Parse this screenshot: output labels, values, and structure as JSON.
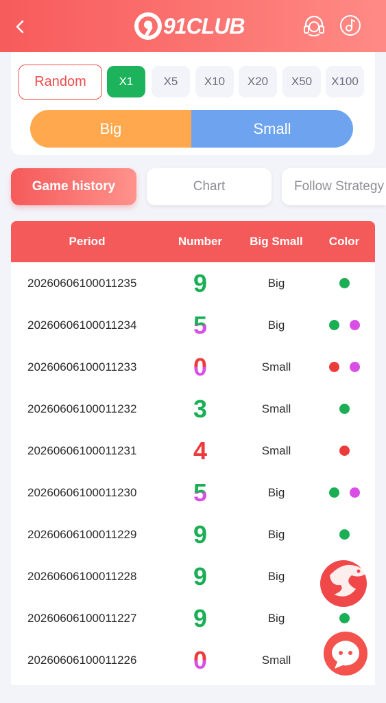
{
  "header": {
    "brand": "91CLUB",
    "icons": [
      "back-icon",
      "headset-icon",
      "music-icon"
    ]
  },
  "bet": {
    "random_label": "Random",
    "multipliers": [
      "X1",
      "X5",
      "X10",
      "X20",
      "X50",
      "X100"
    ],
    "selected_multiplier": "X1",
    "big_label": "Big",
    "small_label": "Small"
  },
  "tabs": {
    "game_history": "Game history",
    "chart": "Chart",
    "follow_strategy": "Follow Strategy",
    "active": "Game history"
  },
  "table": {
    "headers": {
      "period": "Period",
      "number": "Number",
      "big_small": "Big Small",
      "color": "Color"
    },
    "rows": [
      {
        "period": "20260606100011235",
        "number": "9",
        "big_small": "Big",
        "colors": [
          "green"
        ]
      },
      {
        "period": "20260606100011234",
        "number": "5",
        "big_small": "Big",
        "colors": [
          "green",
          "violet"
        ]
      },
      {
        "period": "20260606100011233",
        "number": "0",
        "big_small": "Small",
        "colors": [
          "red",
          "violet"
        ]
      },
      {
        "period": "20260606100011232",
        "number": "3",
        "big_small": "Small",
        "colors": [
          "green"
        ]
      },
      {
        "period": "20260606100011231",
        "number": "4",
        "big_small": "Small",
        "colors": [
          "red"
        ]
      },
      {
        "period": "20260606100011230",
        "number": "5",
        "big_small": "Big",
        "colors": [
          "green",
          "violet"
        ]
      },
      {
        "period": "20260606100011229",
        "number": "9",
        "big_small": "Big",
        "colors": [
          "green"
        ]
      },
      {
        "period": "20260606100011228",
        "number": "9",
        "big_small": "Big",
        "colors": [
          "green"
        ]
      },
      {
        "period": "20260606100011227",
        "number": "9",
        "big_small": "Big",
        "colors": [
          "green"
        ]
      },
      {
        "period": "20260606100011226",
        "number": "0",
        "big_small": "Small",
        "colors": [
          "red",
          "violet"
        ]
      }
    ]
  },
  "colors": {
    "green": "#1aae55",
    "red": "#ec3b3b",
    "violet": "#d94fe6",
    "accent": "#f55a5a",
    "big": "#ffa84d",
    "small": "#6ea4ef"
  },
  "floating": [
    "dragon-icon",
    "chat-icon"
  ]
}
